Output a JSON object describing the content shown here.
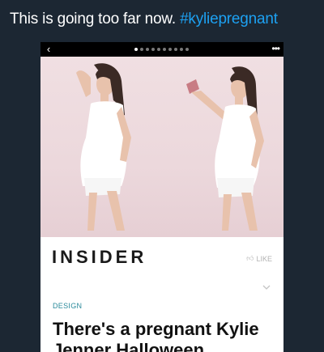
{
  "tweet": {
    "text": "This is going too far now. ",
    "hashtag": "#kyliepregnant"
  },
  "card": {
    "back_icon": "‹",
    "more_icon": "•••",
    "carousel": {
      "total": 10,
      "active": 0
    },
    "publisher": "INSIDER",
    "like_label": "LIKE",
    "category": "DESIGN",
    "headline": "There's a pregnant Kylie Jenner Halloween"
  },
  "colors": {
    "background": "#1c2733",
    "hashtag": "#1da1f2",
    "category": "#2a8a9b"
  }
}
